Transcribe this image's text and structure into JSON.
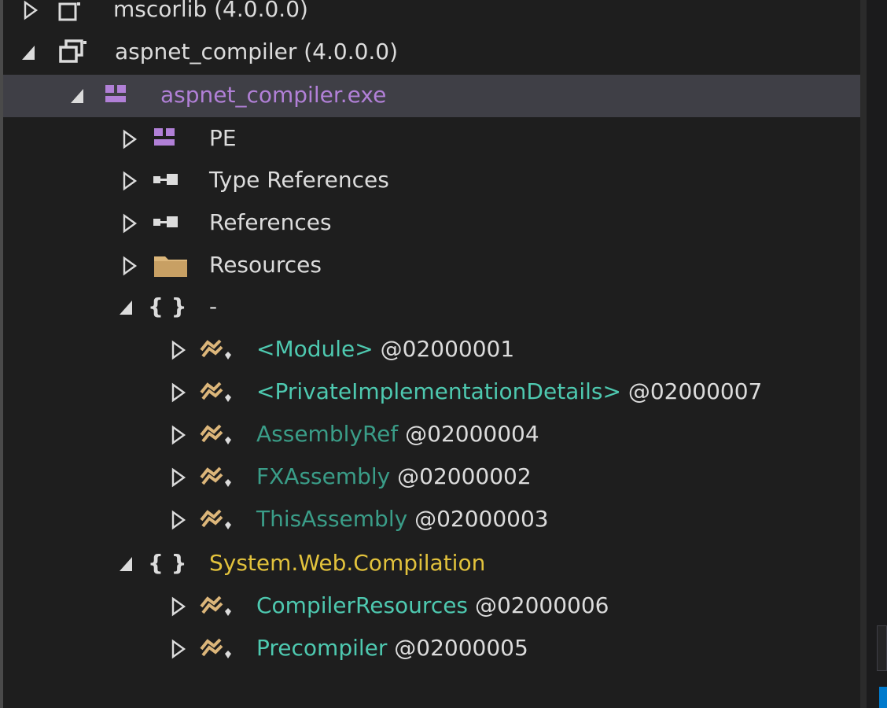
{
  "tree": {
    "rows": [
      {
        "label": "mscorlib (4.0.0.0)",
        "token": "",
        "expander": "collapsed",
        "icon": "assembly-icon"
      },
      {
        "label": "aspnet_compiler (4.0.0.0)",
        "token": "",
        "expander": "expanded",
        "icon": "assembly-icon"
      },
      {
        "label": "aspnet_compiler.exe",
        "token": "",
        "expander": "expanded",
        "icon": "module-icon"
      },
      {
        "label": "PE",
        "token": "",
        "expander": "collapsed",
        "icon": "module-icon"
      },
      {
        "label": "Type References",
        "token": "",
        "expander": "collapsed",
        "icon": "reference-icon"
      },
      {
        "label": "References",
        "token": "",
        "expander": "collapsed",
        "icon": "reference-icon"
      },
      {
        "label": "Resources",
        "token": "",
        "expander": "collapsed",
        "icon": "folder-icon"
      },
      {
        "label": "-",
        "token": "",
        "expander": "expanded",
        "icon": "namespace-icon",
        "braces": "{ }"
      },
      {
        "label": "<Module>",
        "token": "@02000001",
        "expander": "collapsed",
        "icon": "class-icon"
      },
      {
        "label": "<PrivateImplementationDetails>",
        "token": "@02000007",
        "expander": "collapsed",
        "icon": "class-icon"
      },
      {
        "label": "AssemblyRef",
        "token": "@02000004",
        "expander": "collapsed",
        "icon": "class-icon"
      },
      {
        "label": "FXAssembly",
        "token": "@02000002",
        "expander": "collapsed",
        "icon": "class-icon"
      },
      {
        "label": "ThisAssembly",
        "token": "@02000003",
        "expander": "collapsed",
        "icon": "class-icon"
      },
      {
        "label": "System.Web.Compilation",
        "token": "",
        "expander": "expanded",
        "icon": "namespace-icon",
        "braces": "{ }"
      },
      {
        "label": "CompilerResources",
        "token": "@02000006",
        "expander": "collapsed",
        "icon": "class-icon"
      },
      {
        "label": "Precompiler",
        "token": "@02000005",
        "expander": "collapsed",
        "icon": "class-icon"
      }
    ]
  },
  "colors": {
    "background": "#1e1e1e",
    "selected_row": "#3f3f46",
    "text": "#dcdcdc",
    "module": "#b180d7",
    "type": "#4ec9b0",
    "namespace": "#d7ba7d",
    "folder": "#dcb67a"
  }
}
